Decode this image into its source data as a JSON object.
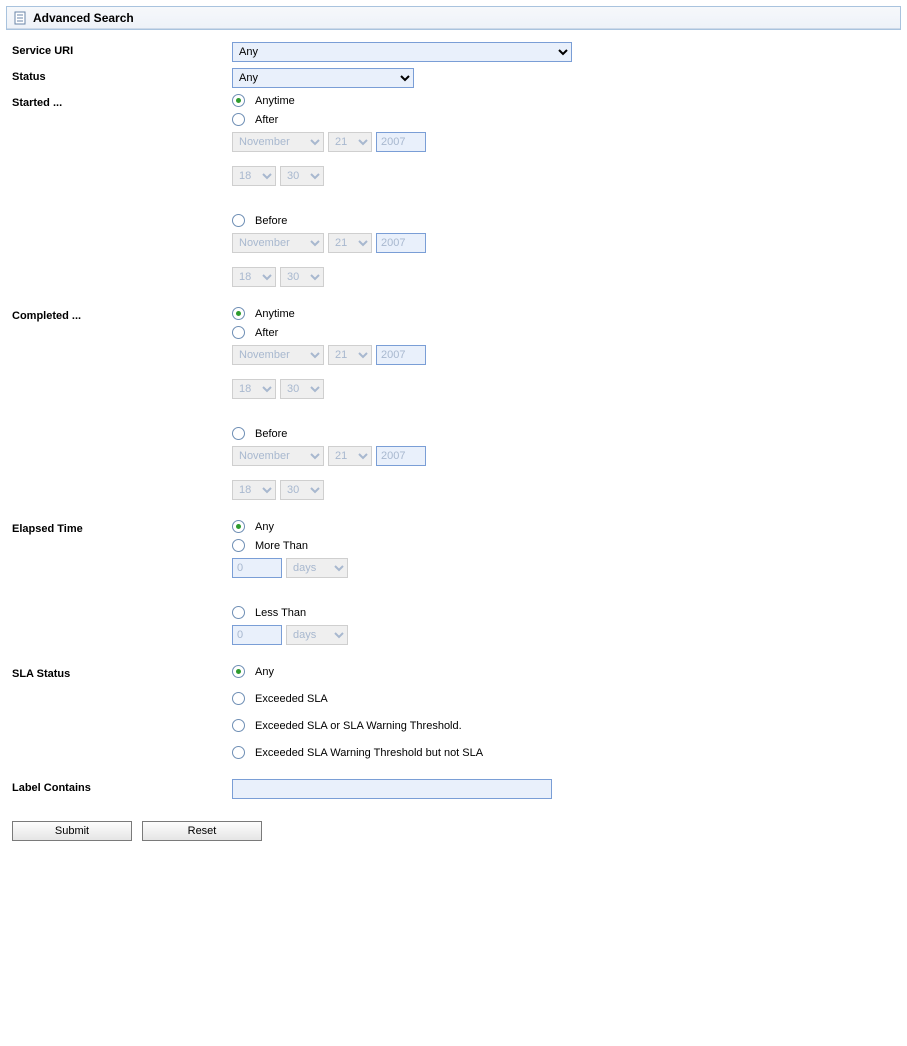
{
  "header": {
    "title": "Advanced Search"
  },
  "labels": {
    "service_uri": "Service URI",
    "status": "Status",
    "started": "Started ...",
    "completed": "Completed ...",
    "elapsed": "Elapsed Time",
    "sla": "SLA Status",
    "label_contains": "Label Contains"
  },
  "service_uri": {
    "selected": "Any"
  },
  "status": {
    "selected": "Any"
  },
  "started": {
    "options": {
      "anytime": "Anytime",
      "after": "After",
      "before": "Before"
    },
    "after": {
      "month": "November",
      "day": "21",
      "year": "2007",
      "hour": "18",
      "minute": "30"
    },
    "before": {
      "month": "November",
      "day": "21",
      "year": "2007",
      "hour": "18",
      "minute": "30"
    }
  },
  "completed": {
    "options": {
      "anytime": "Anytime",
      "after": "After",
      "before": "Before"
    },
    "after": {
      "month": "November",
      "day": "21",
      "year": "2007",
      "hour": "18",
      "minute": "30"
    },
    "before": {
      "month": "November",
      "day": "21",
      "year": "2007",
      "hour": "18",
      "minute": "30"
    }
  },
  "elapsed": {
    "options": {
      "any": "Any",
      "more": "More Than",
      "less": "Less Than"
    },
    "more": {
      "value": "0",
      "unit": "days"
    },
    "less": {
      "value": "0",
      "unit": "days"
    }
  },
  "sla": {
    "options": {
      "any": "Any",
      "exceeded": "Exceeded SLA",
      "exceeded_or_warn": "Exceeded SLA or SLA Warning Threshold.",
      "warn_not_sla": "Exceeded SLA Warning Threshold but not SLA"
    }
  },
  "label_contains": {
    "value": ""
  },
  "buttons": {
    "submit": "Submit",
    "reset": "Reset"
  }
}
